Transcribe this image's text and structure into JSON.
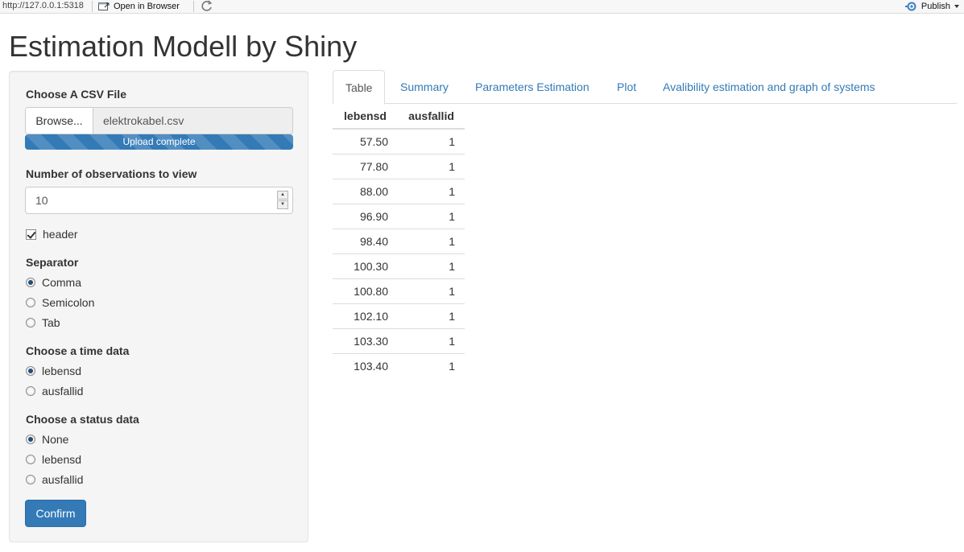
{
  "viewer": {
    "url": "http://127.0.0.1:5318",
    "open_in_browser": "Open in Browser",
    "publish": "Publish"
  },
  "app": {
    "title": "Estimation Modell by Shiny"
  },
  "sidebar": {
    "file_label": "Choose A CSV File",
    "browse_label": "Browse...",
    "file_name": "elektrokabel.csv",
    "upload_status": "Upload complete",
    "obs_label": "Number of observations to view",
    "obs_value": "10",
    "header_label": "header",
    "header_checked": true,
    "separator": {
      "label": "Separator",
      "options": [
        "Comma",
        "Semicolon",
        "Tab"
      ],
      "selected": "Comma"
    },
    "time_data": {
      "label": "Choose a time data",
      "options": [
        "lebensd",
        "ausfallid"
      ],
      "selected": "lebensd"
    },
    "status_data": {
      "label": "Choose a status data",
      "options": [
        "None",
        "lebensd",
        "ausfallid"
      ],
      "selected": "None"
    },
    "confirm_label": "Confirm"
  },
  "tabs": [
    "Table",
    "Summary",
    "Parameters Estimation",
    "Plot",
    "Avalibility estimation and graph of systems"
  ],
  "active_tab": "Table",
  "table": {
    "columns": [
      "lebensd",
      "ausfallid"
    ],
    "rows": [
      [
        "57.50",
        "1"
      ],
      [
        "77.80",
        "1"
      ],
      [
        "88.00",
        "1"
      ],
      [
        "96.90",
        "1"
      ],
      [
        "98.40",
        "1"
      ],
      [
        "100.30",
        "1"
      ],
      [
        "100.80",
        "1"
      ],
      [
        "102.10",
        "1"
      ],
      [
        "103.30",
        "1"
      ],
      [
        "103.40",
        "1"
      ]
    ]
  },
  "colors": {
    "primary": "#337ab7",
    "link": "#337ab7",
    "well": "#f5f5f5"
  }
}
